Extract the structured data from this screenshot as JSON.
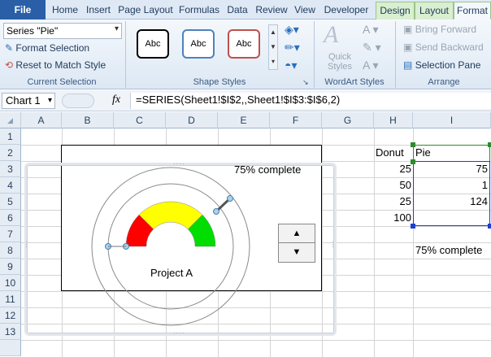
{
  "ribbon_tabs": [
    "File",
    "Home",
    "Insert",
    "Page Layout",
    "Formulas",
    "Data",
    "Review",
    "View",
    "Developer",
    "Design",
    "Layout",
    "Format"
  ],
  "current_selection": {
    "dropdown_value": "Series \"Pie\"",
    "format_selection": "Format Selection",
    "reset_to_match_style": "Reset to Match Style",
    "group_label": "Current Selection"
  },
  "shape_styles": {
    "swatches": [
      "Abc",
      "Abc",
      "Abc"
    ],
    "swatch_colors": [
      "#000000",
      "#4f81bd",
      "#c0504d"
    ],
    "group_label": "Shape Styles"
  },
  "wordart": {
    "quick_styles_line1": "Quick",
    "quick_styles_line2": "Styles",
    "group_label": "WordArt Styles"
  },
  "arrange": {
    "bring_forward": "Bring Forward",
    "send_backward": "Send Backward",
    "selection_pane": "Selection Pane",
    "group_label": "Arrange"
  },
  "formula_bar": {
    "name_box": "Chart 1",
    "fx": "fx",
    "formula": "=SERIES(Sheet1!$I$2,,Sheet1!$I$3:$I$6,2)"
  },
  "columns": [
    "A",
    "B",
    "C",
    "D",
    "E",
    "F",
    "G",
    "H",
    "I"
  ],
  "rows": [
    "1",
    "2",
    "3",
    "4",
    "5",
    "6",
    "7",
    "8",
    "9",
    "10",
    "11",
    "12",
    "13"
  ],
  "cells": {
    "H2": "Donut",
    "I2": "Pie",
    "H3": "25",
    "I3": "75",
    "H4": "50",
    "I4": "1",
    "H5": "25",
    "I5": "124",
    "H6": "100",
    "I8": "75% complete"
  },
  "chart": {
    "title_text": "75% complete",
    "label": "Project A",
    "gauge_colors": [
      "#ff0000",
      "#ffff00",
      "#00dd00"
    ],
    "pie_values": [
      75,
      1,
      124
    ],
    "donut_values": [
      25,
      50,
      25,
      100
    ]
  },
  "spin_button": {
    "up": "▲",
    "down": "▼"
  }
}
